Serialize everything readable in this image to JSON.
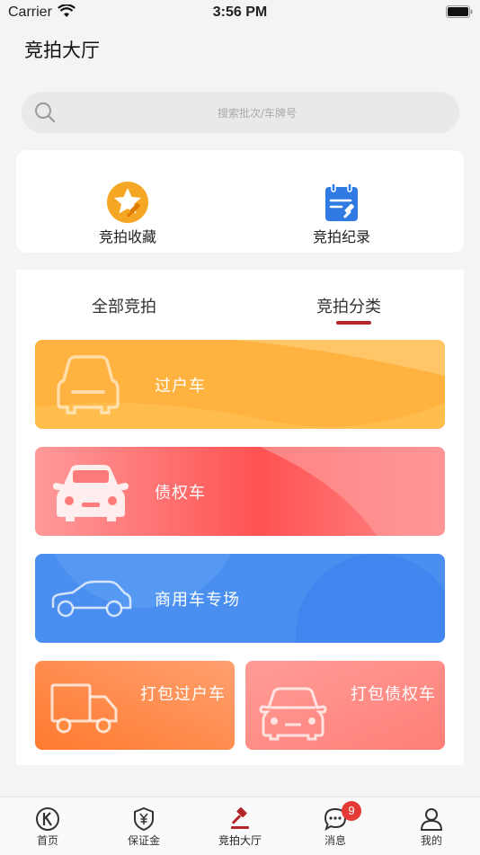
{
  "status_bar": {
    "carrier": "Carrier",
    "time": "3:56 PM"
  },
  "page_title": "竞拍大厅",
  "search": {
    "placeholder": "搜索批次/车牌号"
  },
  "quick_actions": [
    {
      "label": "竞拍收藏",
      "icon": "star-gavel-icon"
    },
    {
      "label": "竞拍纪录",
      "icon": "calendar-gavel-icon"
    }
  ],
  "tabs": [
    {
      "label": "全部竞拍",
      "active": false
    },
    {
      "label": "竞拍分类",
      "active": true
    }
  ],
  "categories": [
    {
      "label": "过户车",
      "icon": "car-front-icon",
      "color": "#ffb648"
    },
    {
      "label": "债权车",
      "icon": "car-front-icon",
      "color": "#ff6f6f"
    },
    {
      "label": "商用车专场",
      "icon": "car-side-icon",
      "color": "#4a90f0"
    },
    {
      "label": "打包过户车",
      "icon": "truck-icon",
      "color": "#ff8a3d"
    },
    {
      "label": "打包债权车",
      "icon": "car-front-icon",
      "color": "#ff8f8a"
    }
  ],
  "tabbar": [
    {
      "label": "首页",
      "icon": "home-k-icon"
    },
    {
      "label": "保证金",
      "icon": "shield-yen-icon"
    },
    {
      "label": "竞拍大厅",
      "icon": "gavel-icon",
      "active": true
    },
    {
      "label": "消息",
      "icon": "chat-icon",
      "badge": "9"
    },
    {
      "label": "我的",
      "icon": "person-icon"
    }
  ],
  "colors": {
    "accent": "#b3262a",
    "badge": "#e53935"
  }
}
